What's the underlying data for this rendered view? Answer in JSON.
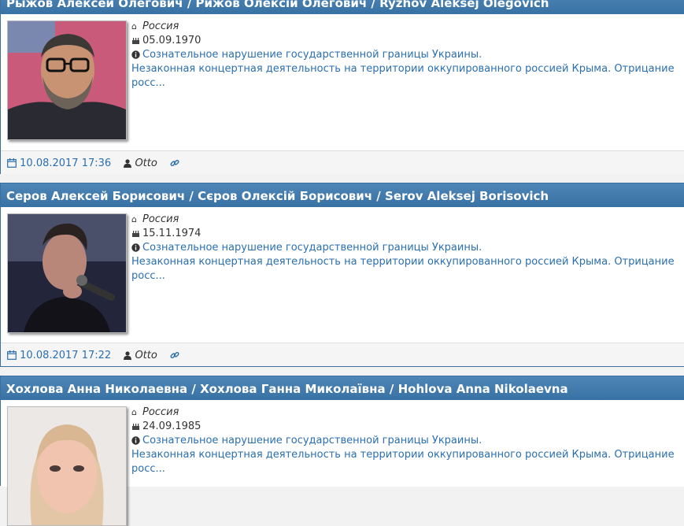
{
  "entries": [
    {
      "title": "Рыжов Алексей Олегович / Рижов Олексій Олегович / Ryzhov Aleksej Olegovich",
      "country": "Россия",
      "birthdate": "05.09.1970",
      "reason_short": "Сознательное нарушение государственной границы Украины.",
      "reason_detail": "Незаконная концертная деятельность на территории оккупированного россией Крыма. Отрицание",
      "reason_more": "росс...",
      "posted": "10.08.2017 17:36",
      "author": "Otto",
      "icons": {
        "country": "home-icon",
        "birth": "birthday-cake-icon",
        "reason": "info-circle-icon",
        "date": "calendar-icon",
        "author": "user-icon",
        "link": "link-icon"
      }
    },
    {
      "title": "Серов Алексей Борисович / Сєров Олексій Борисович / Serov Aleksej Borisovich",
      "country": "Россия",
      "birthdate": "15.11.1974",
      "reason_short": "Сознательное нарушение государственной границы Украины.",
      "reason_detail": "Незаконная концертная деятельность на территории оккупированного россией Крыма. Отрицание",
      "reason_more": "росс...",
      "posted": "10.08.2017 17:22",
      "author": "Otto"
    },
    {
      "title": "Хохлова Анна Николаевна / Хохлова Ганна Миколаївна / Hohlova Anna Nikolaevna",
      "country": "Россия",
      "birthdate": "24.09.1985",
      "reason_short": "Сознательное нарушение государственной границы Украины.",
      "reason_detail": "Незаконная концертная деятельность на территории оккупированного россией Крыма. Отрицание",
      "reason_more": "росс..."
    }
  ],
  "colors": {
    "header": "#3e77aa",
    "link": "#2a6fb0",
    "border": "#3a6f9f"
  }
}
